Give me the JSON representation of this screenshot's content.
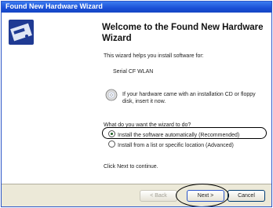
{
  "window": {
    "title": "Found New Hardware Wizard"
  },
  "wizard": {
    "heading": "Welcome to the Found New Hardware Wizard",
    "intro": "This wizard helps you install software for:",
    "device": "Serial CF WLAN",
    "cd_note": "If your hardware came with an installation CD or floppy disk, insert it now.",
    "question": "What do you want the wizard to do?",
    "option_auto": "Install the software automatically (Recommended)",
    "option_manual": "Install from a list or specific location (Advanced)",
    "selected_option": "auto",
    "next_note": "Click Next to continue."
  },
  "buttons": {
    "back": "< Back",
    "next": "Next >",
    "cancel": "Cancel"
  },
  "icons": {
    "wizard": "hardware-wizard-icon",
    "cd": "cd-icon"
  },
  "colors": {
    "titlebar": "#1a4fd6",
    "dialog_bg": "#ece9d8"
  }
}
